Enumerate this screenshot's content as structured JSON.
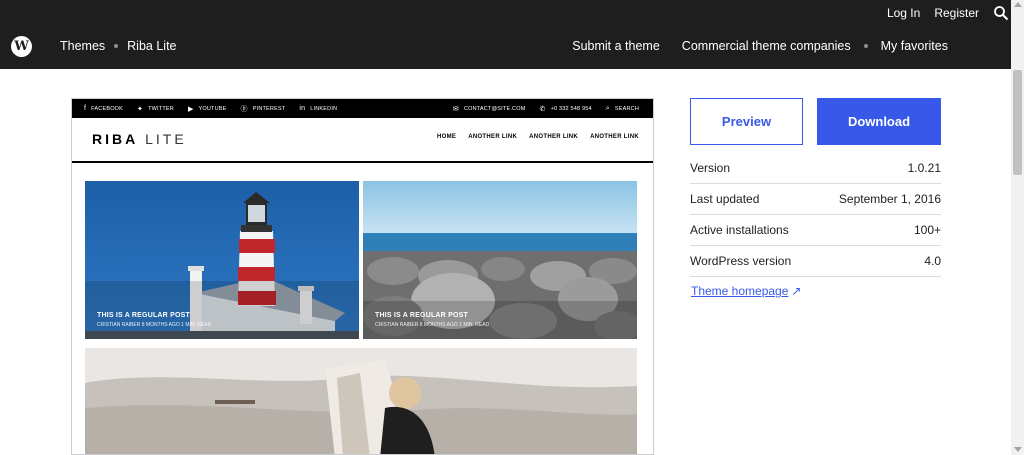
{
  "topbar": {
    "login": "Log In",
    "register": "Register",
    "breadcrumb": [
      "Themes",
      "Riba Lite"
    ],
    "nav": [
      "Submit a theme",
      "Commercial theme companies",
      "My favorites"
    ]
  },
  "preview_shot": {
    "social": [
      "FACEBOOK",
      "TWITTER",
      "YOUTUBE",
      "PINTEREST",
      "LINKEDIN"
    ],
    "contact_email": "CONTACT@SITE.COM",
    "phone": "+0 332 548 954",
    "search": "SEARCH",
    "logo_main": "RIBA",
    "logo_sub": "LITE",
    "nav": [
      "HOME",
      "ANOTHER LINK",
      "ANOTHER LINK",
      "ANOTHER LINK"
    ],
    "posts": [
      {
        "title": "THIS IS A REGULAR POST",
        "meta": "CRISTIAN RAIBER   8 MONTHS AGO   1 MIN. READ"
      },
      {
        "title": "THIS IS A REGULAR POST",
        "meta": "CRISTIAN RAIBER   8 MONTHS AGO   1 MIN. READ"
      }
    ]
  },
  "actions": {
    "preview": "Preview",
    "download": "Download"
  },
  "meta": [
    {
      "label": "Version",
      "value": "1.0.21"
    },
    {
      "label": "Last updated",
      "value": "September 1, 2016"
    },
    {
      "label": "Active installations",
      "value": "100+"
    },
    {
      "label": "WordPress version",
      "value": "4.0"
    }
  ],
  "theme_homepage": "Theme homepage",
  "colors": {
    "accent": "#3858e9",
    "header_bg": "#1e1e1e"
  }
}
